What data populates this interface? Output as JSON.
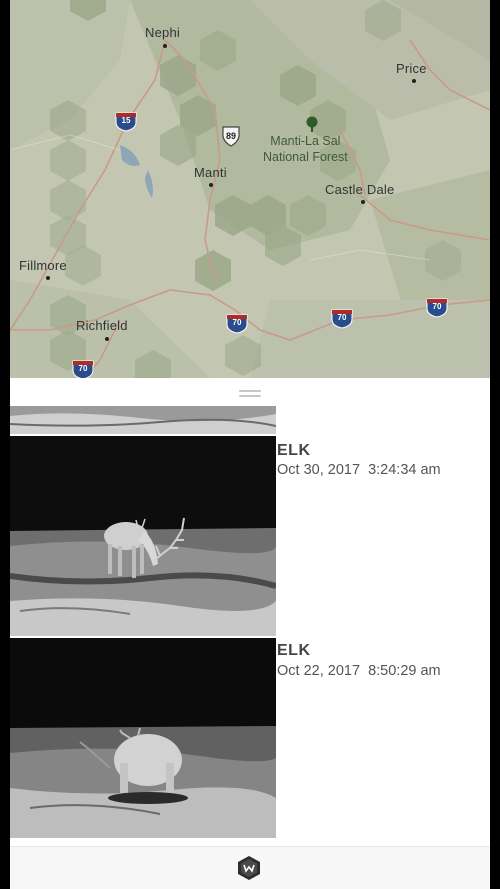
{
  "map": {
    "cities": [
      {
        "id": "nephi",
        "name": "Nephi"
      },
      {
        "id": "price",
        "name": "Price"
      },
      {
        "id": "manti",
        "name": "Manti"
      },
      {
        "id": "castle-dale",
        "name": "Castle Dale"
      },
      {
        "id": "fillmore",
        "name": "Fillmore"
      },
      {
        "id": "richfield",
        "name": "Richfield"
      }
    ],
    "forest": {
      "line1": "Manti-La Sal",
      "line2": "National Forest"
    },
    "highways": {
      "i15": "15",
      "us89": "89",
      "i70": "70"
    }
  },
  "sheet": {
    "entries": [
      {
        "title": "ELK",
        "date": "Oct 30, 2017  3:24:34 am"
      },
      {
        "title": "ELK",
        "date": "Oct 22, 2017  8:50:29 am"
      }
    ]
  },
  "colors": {
    "map_base": "#c3c7b2",
    "map_hex_green": "#a3ad8f",
    "road": "#c89a8a",
    "interstate_blue": "#2b4c8c",
    "interstate_red": "#b02a2a"
  },
  "icons": {
    "forest": "tree-icon",
    "app": "wildlife-logo-icon",
    "handle": "drag-handle-icon"
  }
}
